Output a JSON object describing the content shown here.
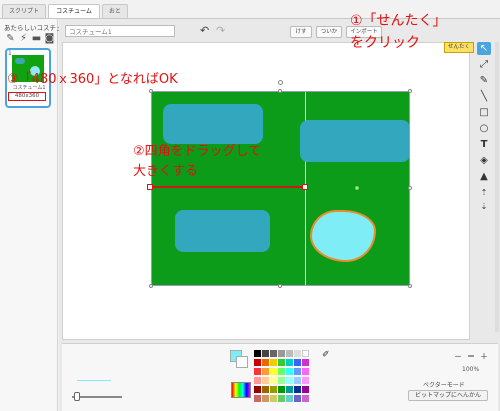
{
  "tabs": [
    {
      "label": "スクリプト"
    },
    {
      "label": "コスチューム"
    },
    {
      "label": "おと"
    }
  ],
  "left_panel": {
    "title": "あたらしいコスチューム：",
    "icons": [
      "brush-icon",
      "wand-icon",
      "folder-icon",
      "camera-icon"
    ],
    "costume": {
      "index": "1",
      "name": "コスチューム1",
      "size": "480x360"
    }
  },
  "editor": {
    "name_value": "コスチューム1",
    "buttons": [
      "けす",
      "ついか",
      "インポート"
    ],
    "tooltip": "せんたく",
    "zoom_level": "100%",
    "mode_label": "ベクターモード",
    "convert_button": "ビットマップにへんかん"
  },
  "annotations": {
    "step1_line1": "①「せんたく」",
    "step1_line2": "をクリック",
    "step2_line1": "②四角をドラッグして",
    "step2_line2": "大きくする",
    "step3": "③「480ｘ360」となればOK"
  },
  "colors": {
    "selected_fill": "#7eedf6",
    "map_green": "#0d9b1a",
    "annotation_red": "#e21010",
    "accent_blue": "#4aa4e0"
  }
}
